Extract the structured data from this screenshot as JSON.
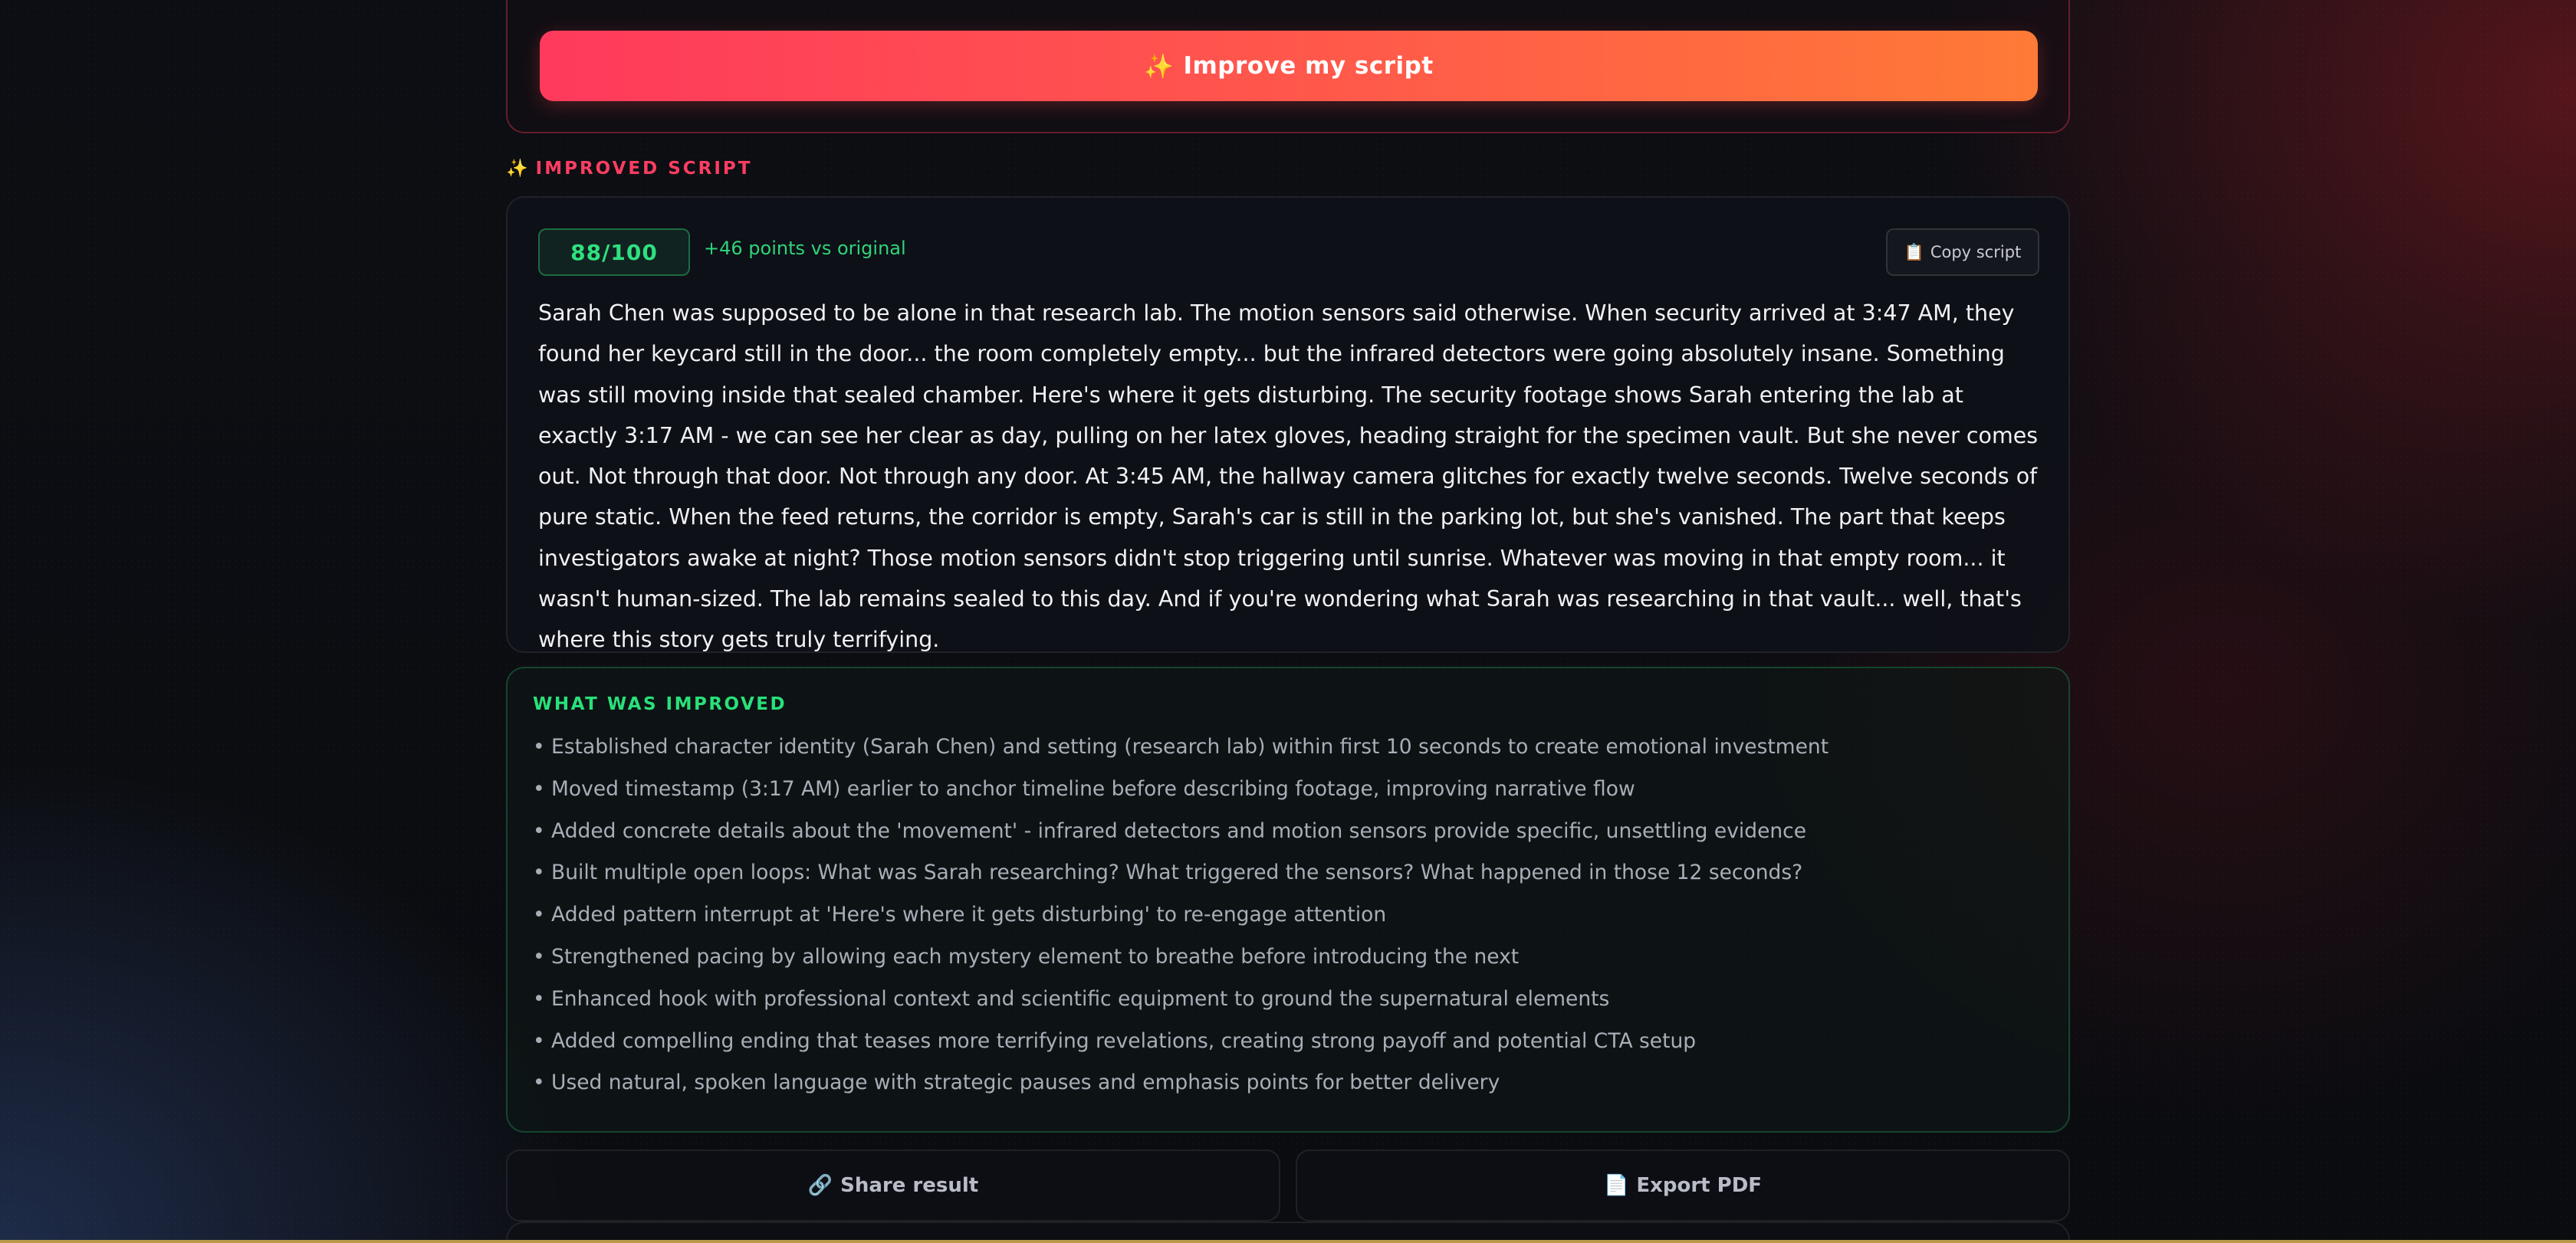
{
  "improve_button": {
    "label": "Improve my script",
    "icon": "sparkles-icon"
  },
  "improved_section": {
    "label": "IMPROVED SCRIPT",
    "icon": "sparkles-icon"
  },
  "script_card": {
    "score": "88/100",
    "delta": "+46 points vs original",
    "copy_label": "Copy script",
    "copy_icon": "clipboard-icon",
    "text": "Sarah Chen was supposed to be alone in that research lab. The motion sensors said otherwise. When security arrived at 3:47 AM, they found her keycard still in the door... the room completely empty... but the infrared detectors were going absolutely insane. Something was still moving inside that sealed chamber. Here's where it gets disturbing. The security footage shows Sarah entering the lab at exactly 3:17 AM - we can see her clear as day, pulling on her latex gloves, heading straight for the specimen vault. But she never comes out. Not through that door. Not through any door. At 3:45 AM, the hallway camera glitches for exactly twelve seconds. Twelve seconds of pure static. When the feed returns, the corridor is empty, Sarah's car is still in the parking lot, but she's vanished. The part that keeps investigators awake at night? Those motion sensors didn't stop triggering until sunrise. Whatever was moving in that empty room... it wasn't human-sized. The lab remains sealed to this day. And if you're wondering what Sarah was researching in that vault... well, that's where this story gets truly terrifying."
  },
  "improvements": {
    "title": "WHAT WAS IMPROVED",
    "items": [
      "• Established character identity (Sarah Chen) and setting (research lab) within first 10 seconds to create emotional investment",
      "• Moved timestamp (3:17 AM) earlier to anchor timeline before describing footage, improving narrative flow",
      "• Added concrete details about the 'movement' - infrared detectors and motion sensors provide specific, unsettling evidence",
      "• Built multiple open loops: What was Sarah researching? What triggered the sensors? What happened in those 12 seconds?",
      "• Added pattern interrupt at 'Here's where it gets disturbing' to re-engage attention",
      "• Strengthened pacing by allowing each mystery element to breathe before introducing the next",
      "• Enhanced hook with professional context and scientific equipment to ground the supernatural elements",
      "• Added compelling ending that teases more terrifying revelations, creating strong payoff and potential CTA setup",
      "• Used natural, spoken language with strategic pauses and emphasis points for better delivery"
    ]
  },
  "actions": {
    "share_label": "Share result",
    "share_icon": "link-icon",
    "export_label": "Export PDF",
    "export_icon": "document-icon"
  },
  "colors": {
    "accent_red": "#ff3d62",
    "accent_orange": "#ff7a36",
    "success_green": "#2fe07f"
  }
}
